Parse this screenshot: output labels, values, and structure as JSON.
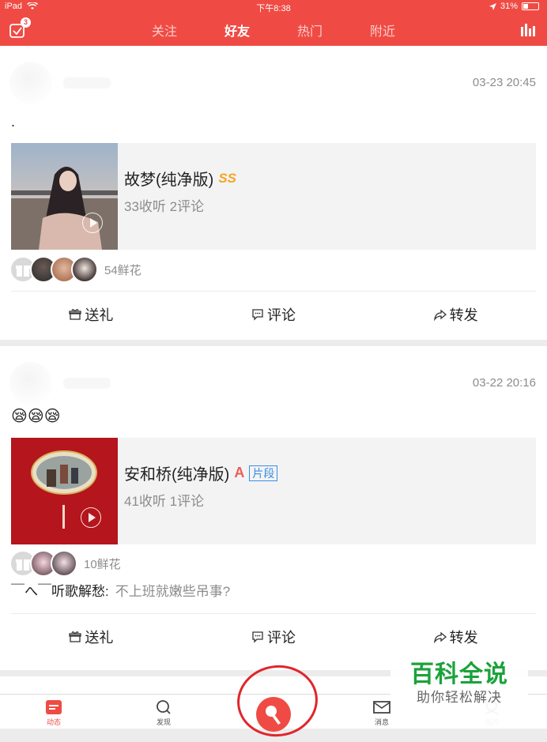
{
  "status_bar": {
    "carrier": "iPad",
    "time": "下午8:38",
    "battery": "31%",
    "battery_level": 0.31
  },
  "nav": {
    "tabs": [
      {
        "label": "关注",
        "active": false
      },
      {
        "label": "好友",
        "active": true
      },
      {
        "label": "热门",
        "active": false
      },
      {
        "label": "附近",
        "active": false
      }
    ],
    "notification_count": "3"
  },
  "posts": [
    {
      "time": "03-23 20:45",
      "text": ".",
      "song": {
        "title": "故梦(纯净版)",
        "level_badge": "SS",
        "stats": "33收听 2评论"
      },
      "flower_count": "54鲜花",
      "actions": {
        "gift": "送礼",
        "comment": "评论",
        "share": "转发"
      }
    },
    {
      "time": "03-22 20:16",
      "emoji": "😪😪😪",
      "song": {
        "title": "安和桥(纯净版)",
        "level_badge": "A",
        "segment_badge": "片段",
        "stats": "41收听 1评论"
      },
      "flower_count": "10鲜花",
      "comment": {
        "author": "￣へ￣听歌解愁:",
        "text": "不上班就嫩些吊事?"
      },
      "actions": {
        "gift": "送礼",
        "comment": "评论",
        "share": "转发"
      }
    }
  ],
  "tab_bar": {
    "items": [
      {
        "label": "动态",
        "icon": "feed-icon",
        "active": true
      },
      {
        "label": "发现",
        "icon": "search-icon",
        "active": false
      },
      {
        "label": "消息",
        "icon": "mail-icon",
        "active": false
      },
      {
        "label": "我的",
        "icon": "profile-icon",
        "active": false
      }
    ]
  },
  "watermark": {
    "title": "百科全说",
    "subtitle": "助你轻松解决"
  },
  "colors": {
    "brand": "#ef4b44",
    "muted": "#8c8c8c",
    "watermark_green": "#1aa33a"
  }
}
